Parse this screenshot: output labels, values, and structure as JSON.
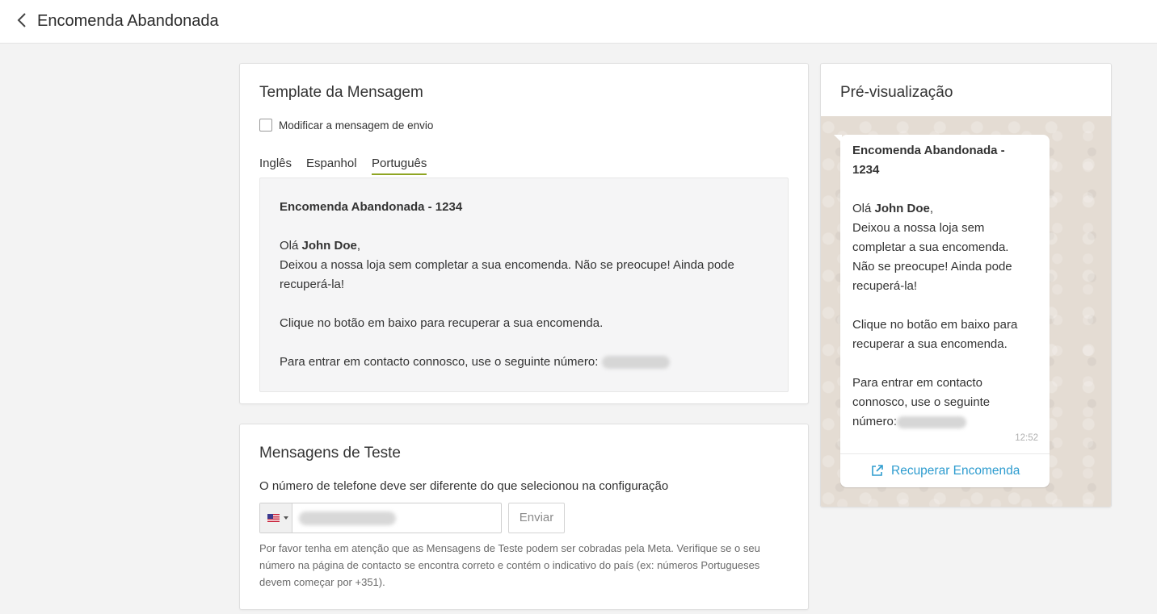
{
  "header": {
    "title": "Encomenda Abandonada"
  },
  "template": {
    "title": "Template da Mensagem",
    "checkbox_label": "Modificar a mensagem de envio",
    "tabs": [
      "Inglês",
      "Espanhol",
      "Português"
    ],
    "active_tab": "Português",
    "message": {
      "heading": "Encomenda Abandonada - 1234",
      "greeting": "Olá ",
      "customer_name": "John Doe",
      "greeting_end": ",",
      "body_line1": "Deixou a nossa loja sem completar a sua encomenda. Não se preocupe! Ainda pode",
      "body_line2": "recuperá-la!",
      "cta_text": "Clique no botão em baixo para recuperar a sua encomenda.",
      "contact_text": "Para entrar em contacto connosco, use o seguinte número:"
    }
  },
  "test": {
    "title": "Mensagens de Teste",
    "hint": "O número de telefone deve ser diferente do que selecionou na configuração",
    "country_flag": "us-flag-icon",
    "send_label": "Enviar",
    "note": "Por favor tenha em atenção que as Mensagens de Teste podem ser cobradas pela Meta. Verifique se o seu número na página de contacto se encontra correto e contém o indicativo do país (ex: números Portugueses devem começar por +351)."
  },
  "preview": {
    "title": "Pré-visualização",
    "heading_line1": "Encomenda Abandonada -",
    "heading_line2": "1234",
    "greeting": "Olá ",
    "customer_name": "John Doe",
    "greeting_end": ",",
    "lines": [
      "Deixou a nossa loja sem",
      "completar a sua encomenda.",
      "Não se preocupe! Ainda pode",
      "recuperá-la!"
    ],
    "cta_lines": [
      "Clique no botão em baixo para",
      "recuperar a sua encomenda."
    ],
    "contact_lines": [
      "Para entrar em contacto",
      "connosco, use o seguinte"
    ],
    "contact_last": "número:",
    "time": "12:52",
    "button_label": "Recuperar Encomenda"
  },
  "colors": {
    "tab_underline": "#8fa523",
    "link": "#2e9ccf",
    "chat_background": "#e4dcd3"
  }
}
